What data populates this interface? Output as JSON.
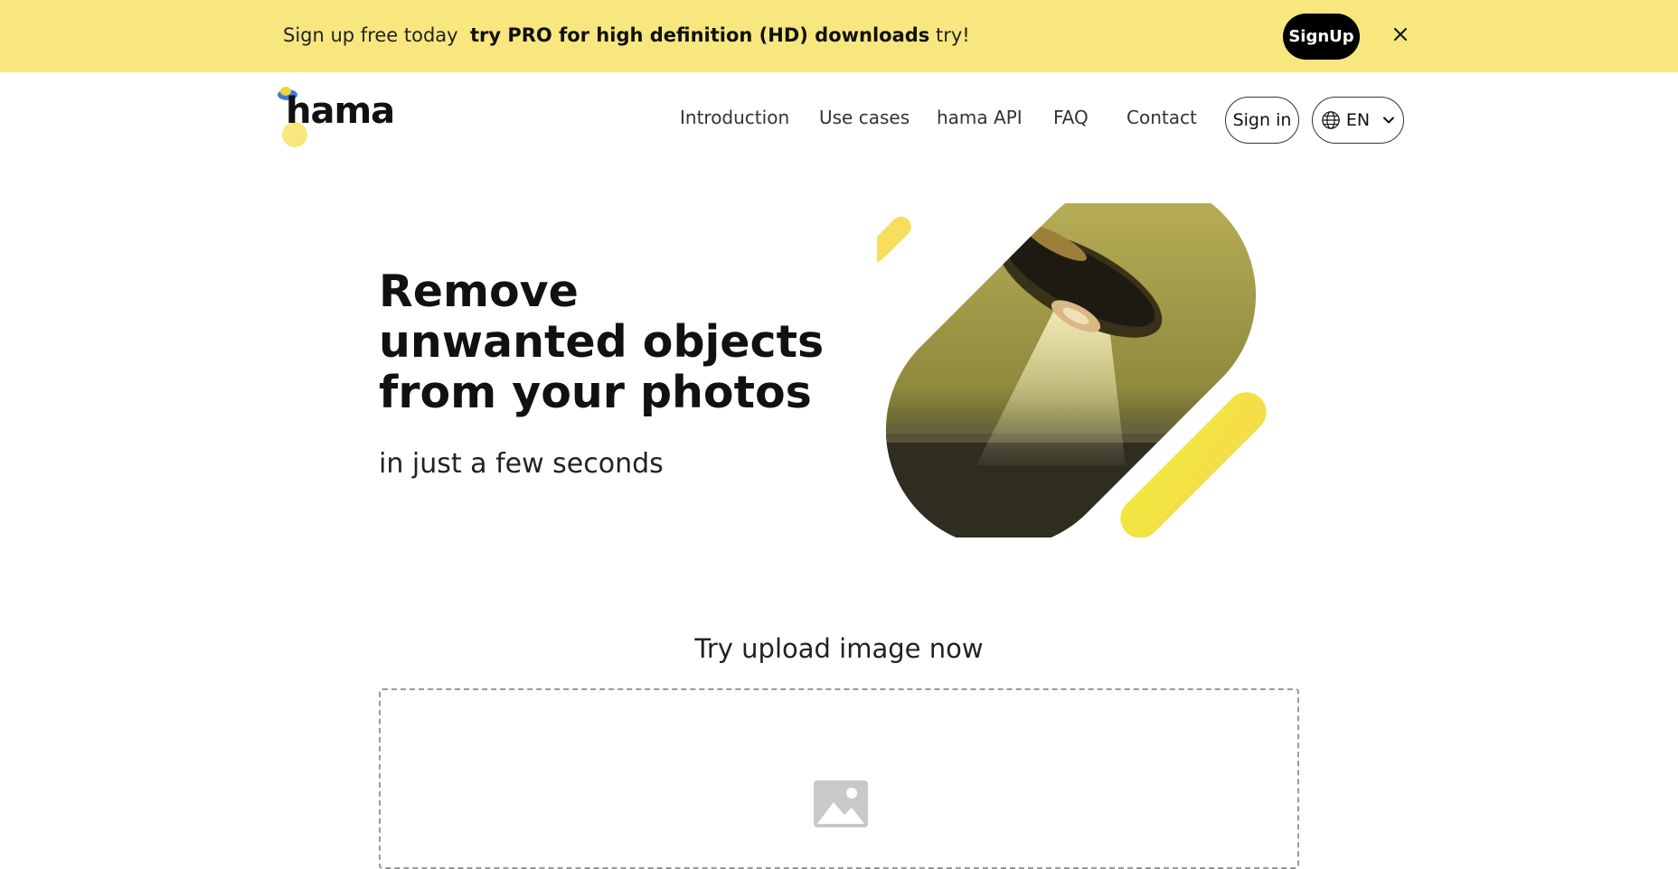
{
  "promo": {
    "lead": "Sign up free today",
    "bold": "try PRO for high definition (HD) downloads",
    "tail": "try!",
    "signup_label": "SignUp"
  },
  "header": {
    "logo_text": "hama",
    "nav": [
      "Introduction",
      "Use cases",
      "hama API",
      "FAQ",
      "Contact"
    ],
    "signin_label": "Sign in",
    "language": "EN"
  },
  "hero": {
    "line1": "Remove",
    "line2": "unwanted objects",
    "line3": "from your photos",
    "subtitle": "in just a few seconds"
  },
  "upload": {
    "title": "Try upload image now"
  },
  "colors": {
    "accent_yellow": "#f8e77e",
    "bright_yellow": "#f2e547",
    "text": "#111111"
  },
  "icons": [
    "close-icon",
    "globe-icon",
    "chevron-down-icon",
    "image-icon"
  ]
}
